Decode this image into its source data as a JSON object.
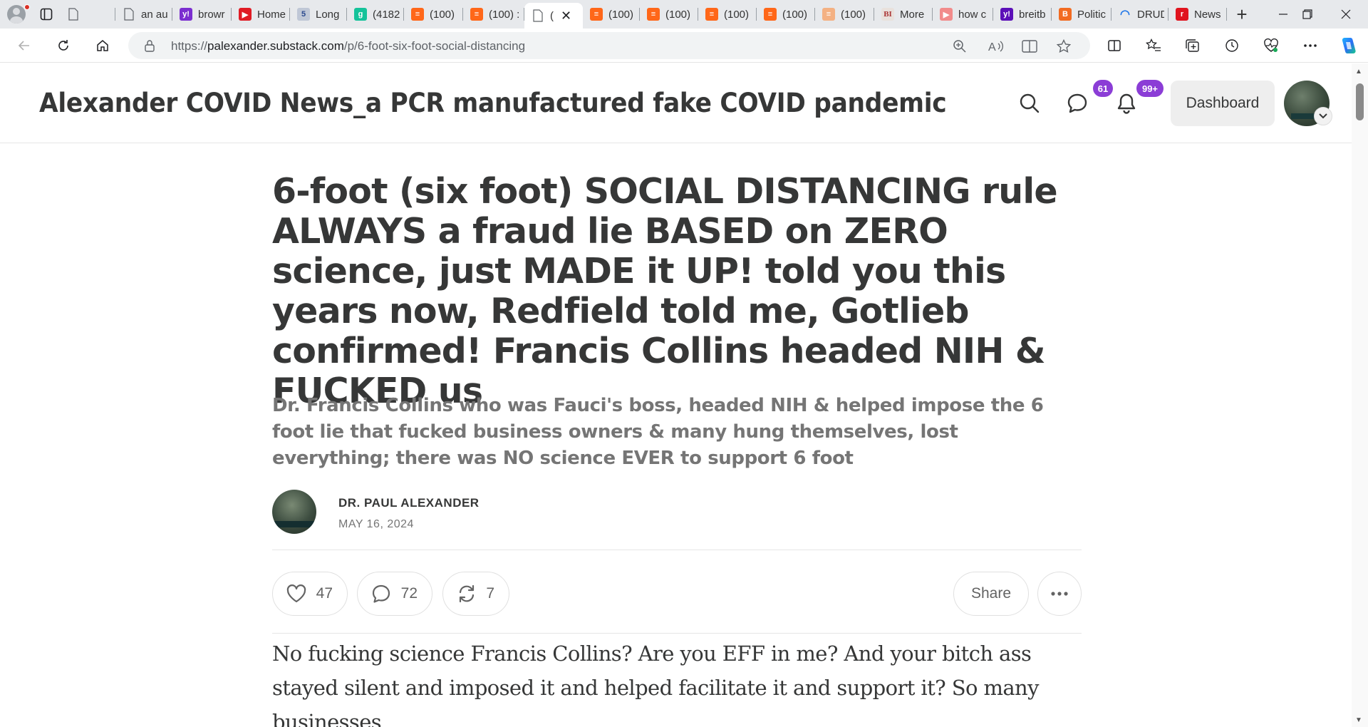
{
  "browser": {
    "tabs": [
      {
        "title": "",
        "favicon": "page-icon",
        "color": "#ffffff"
      },
      {
        "title": "an au",
        "favicon": "page-icon",
        "color": "#ffffff"
      },
      {
        "title": "browr",
        "favicon": "yahoo-icon",
        "color": "#7b2ed0"
      },
      {
        "title": "Home",
        "favicon": "rumble-icon",
        "color": "#e01b24"
      },
      {
        "title": "Long",
        "favicon": "fivethirtyeight-icon",
        "color": "#bfc7d6"
      },
      {
        "title": "(4182",
        "favicon": "grammarly-icon",
        "color": "#15c39a"
      },
      {
        "title": "(100)",
        "favicon": "substack-icon",
        "color": "#ff6719"
      },
      {
        "title": "(100) :",
        "favicon": "substack-icon",
        "color": "#ff6719"
      },
      {
        "title": "(",
        "favicon": "page-icon",
        "color": "#ffffff",
        "active": true
      },
      {
        "title": "(100)",
        "favicon": "substack-icon",
        "color": "#ff6719"
      },
      {
        "title": "(100)",
        "favicon": "substack-icon",
        "color": "#ff6719"
      },
      {
        "title": "(100)",
        "favicon": "substack-icon",
        "color": "#ff6719"
      },
      {
        "title": "(100)",
        "favicon": "substack-icon",
        "color": "#ff6719"
      },
      {
        "title": "(100)",
        "favicon": "substack-icon",
        "color": "#f4b183"
      },
      {
        "title": "More",
        "favicon": "bi-icon",
        "color": "#e9e1dc"
      },
      {
        "title": "how c",
        "favicon": "youtube-icon",
        "color": "#f28b8b"
      },
      {
        "title": "breitb",
        "favicon": "yahoo-icon",
        "color": "#5b0fb8"
      },
      {
        "title": "Politic",
        "favicon": "b-icon",
        "color": "#f26b21"
      },
      {
        "title": "DRUD",
        "favicon": "loading-icon",
        "color": "#e7e9ec"
      },
      {
        "title": "News",
        "favicon": "r-icon",
        "color": "#e0141e"
      }
    ],
    "url_prefix": "https://",
    "url_domain": "palexander.substack.com",
    "url_path": "/p/6-foot-six-foot-social-distancing"
  },
  "header": {
    "site_title": "Alexander COVID News_a PCR manufactured fake COVID pandemic",
    "chat_badge": "61",
    "notif_badge": "99+",
    "dashboard_label": "Dashboard"
  },
  "post": {
    "title": "6-foot (six foot) SOCIAL DISTANCING rule ALWAYS a fraud lie BASED on ZERO science, just MADE it UP! told you this years now, Redfield told me, Gotlieb confirmed! Francis Collins headed NIH & FUCKED us",
    "subtitle": "Dr. Francis Collins who was Fauci's boss, headed NIH & helped impose the 6 foot lie that fucked business owners & many hung themselves, lost everything; there was NO science EVER to support 6 foot",
    "author": "DR. PAUL ALEXANDER",
    "date": "MAY 16, 2024",
    "likes": "47",
    "comments": "72",
    "restacks": "7",
    "share_label": "Share",
    "body": "No fucking science Francis Collins? Are you EFF in me? And your bitch ass stayed silent and imposed it and helped facilitate it and support it? So many businesses"
  }
}
